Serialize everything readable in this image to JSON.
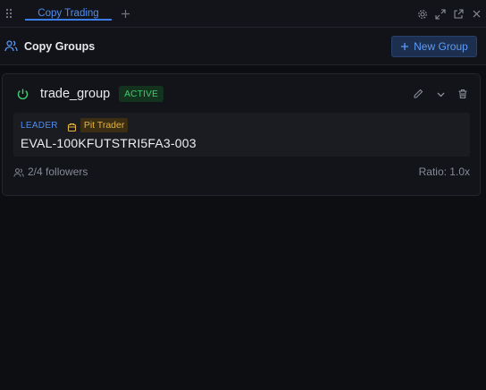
{
  "tabs": [
    {
      "label": "Copy Trading",
      "active": true
    }
  ],
  "header": {
    "title": "Copy Groups",
    "new_group_label": "New Group"
  },
  "group": {
    "name": "trade_group",
    "status": "ACTIVE",
    "leader_label": "LEADER",
    "leader_badge": "Pit Trader",
    "account_id": "EVAL-100KFUTSTRI5FA3-003",
    "followers": "2/4 followers",
    "ratio": "Ratio: 1.0x"
  },
  "colors": {
    "accent": "#3b7ee8",
    "active": "#3dcf6c",
    "badge": "#e3b341",
    "background": "#0d0e12"
  },
  "icons": [
    "drag-handle-icon",
    "plus-icon",
    "gear-icon",
    "expand-icon",
    "external-link-icon",
    "close-icon",
    "users-icon",
    "power-icon",
    "pencil-icon",
    "chevron-down-icon",
    "trash-icon",
    "trader-icon",
    "followers-icon"
  ]
}
